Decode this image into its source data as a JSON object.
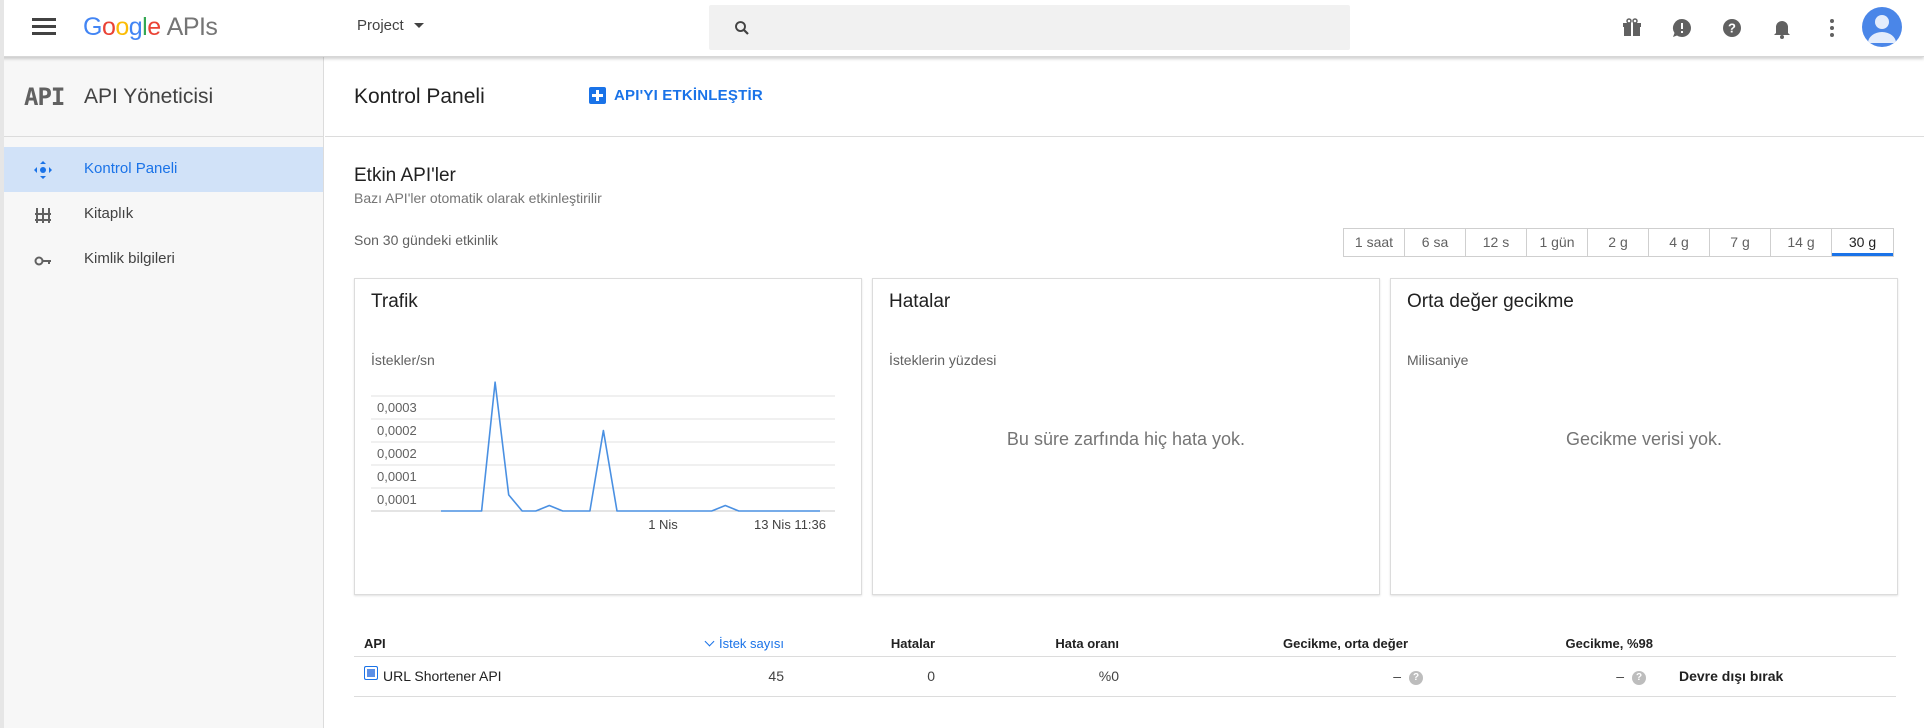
{
  "topbar": {
    "logo_parts": [
      "G",
      "o",
      "o",
      "g",
      "l",
      "e"
    ],
    "logo_suffix": "APIs",
    "project_label": "Project",
    "search_placeholder": "",
    "icons": [
      "gift-icon",
      "feedback-icon",
      "help-icon",
      "notifications-icon",
      "more-vert-icon"
    ]
  },
  "sidebar": {
    "mark": "API",
    "title": "API Yöneticisi",
    "items": [
      {
        "label": "Kontrol Paneli",
        "icon": "dashboard-icon",
        "active": true
      },
      {
        "label": "Kitaplık",
        "icon": "library-icon",
        "active": false
      },
      {
        "label": "Kimlik bilgileri",
        "icon": "key-icon",
        "active": false
      }
    ]
  },
  "main": {
    "title": "Kontrol Paneli",
    "enable_button": "API'YI ETKİNLEŞTİR",
    "section_title": "Etkin API'ler",
    "section_subtitle": "Bazı API'ler otomatik olarak etkinleştirilir",
    "activity_label": "Son 30 gündeki etkinlik",
    "ranges": [
      "1 saat",
      "6 sa",
      "12 s",
      "1 gün",
      "2 g",
      "4 g",
      "7 g",
      "14 g",
      "30 g"
    ],
    "selected_range": "30 g"
  },
  "cards": {
    "traffic": {
      "title": "Trafik",
      "unit": "İstekler/sn"
    },
    "errors": {
      "title": "Hatalar",
      "unit": "İsteklerin yüzdesi",
      "empty": "Bu süre zarfında hiç hata yok."
    },
    "latency": {
      "title": "Orta değer gecikme",
      "unit": "Milisaniye",
      "empty": "Gecikme verisi yok."
    }
  },
  "chart_data": {
    "type": "line",
    "title": "Trafik",
    "ylabel": "İstekler/sn",
    "xlabel": "",
    "y_tick_labels": [
      "0,0003",
      "0,0002",
      "0,0002",
      "0,0001",
      "0,0001"
    ],
    "x_tick_labels": [
      "1 Nis",
      "13 Nis 11:36"
    ],
    "ylim": [
      0,
      0.00025
    ],
    "grid": true,
    "color": "#4a90e2",
    "series": [
      {
        "values": [
          0,
          0,
          0,
          0,
          0.00028,
          3.5e-05,
          0,
          0,
          1.2e-05,
          0,
          0,
          0,
          0.000175,
          0,
          0,
          0,
          0,
          0,
          0,
          0,
          0,
          1.2e-05,
          0,
          0,
          0,
          0,
          0,
          0,
          0
        ]
      }
    ]
  },
  "table": {
    "headers": {
      "api": "API",
      "requests": "İstek sayısı",
      "errors": "Hatalar",
      "error_rate": "Hata oranı",
      "latency_median": "Gecikme, orta değer",
      "latency_98": "Gecikme, %98"
    },
    "rows": [
      {
        "name": "URL Shortener API",
        "requests": "45",
        "errors": "0",
        "error_rate": "%0",
        "latency_median": "–",
        "latency_98": "–",
        "action": "Devre dışı bırak"
      }
    ],
    "help_glyph": "?"
  }
}
